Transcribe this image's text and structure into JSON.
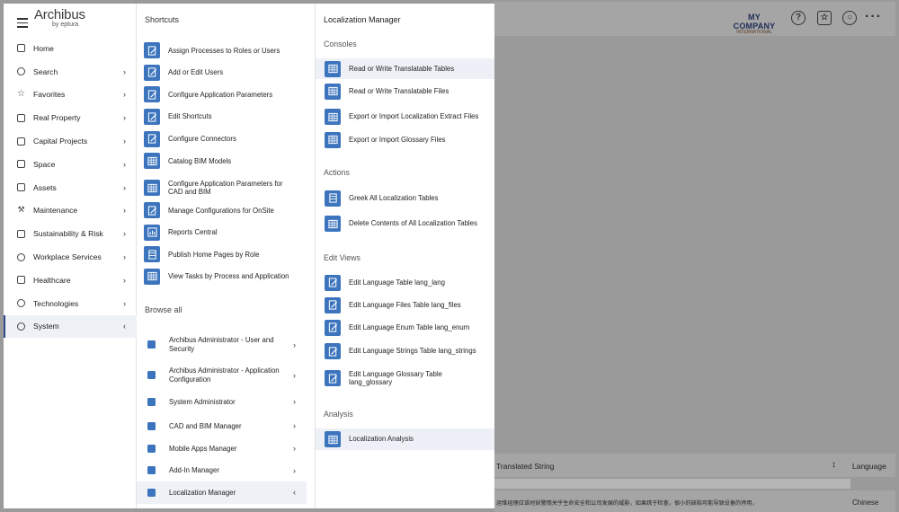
{
  "background": {
    "company_logo_line1": "MY COMPANY",
    "company_logo_line2": "INTERNATIONAL",
    "table_header_translated": "Translated String",
    "table_header_language": "Language",
    "row_text": "运维经理应该时刻警惕关乎生命安全和公司发展的威胁，如果疏于检查，很小的缺陷可能导致设备的停用，",
    "row_language": "Chinese",
    "icons": [
      "help-icon",
      "favorites-icon",
      "user-icon",
      "more-icon"
    ]
  },
  "nav": {
    "brand_name": "Archibus",
    "brand_by": "by eptura",
    "items": [
      {
        "label": "Home",
        "icon": "home-icon",
        "chevron": ""
      },
      {
        "label": "Search",
        "icon": "search-icon",
        "chevron": "›"
      },
      {
        "label": "Favorites",
        "icon": "star-icon",
        "chevron": "›"
      },
      {
        "label": "Real Property",
        "icon": "building-icon",
        "chevron": "›"
      },
      {
        "label": "Capital Projects",
        "icon": "projects-icon",
        "chevron": "›"
      },
      {
        "label": "Space",
        "icon": "space-icon",
        "chevron": "›"
      },
      {
        "label": "Assets",
        "icon": "assets-icon",
        "chevron": "›"
      },
      {
        "label": "Maintenance",
        "icon": "wrench-icon",
        "chevron": "›"
      },
      {
        "label": "Sustainability & Risk",
        "icon": "leaf-icon",
        "chevron": "›"
      },
      {
        "label": "Workplace Services",
        "icon": "services-icon",
        "chevron": "›"
      },
      {
        "label": "Healthcare",
        "icon": "healthcare-icon",
        "chevron": "›"
      },
      {
        "label": "Technologies",
        "icon": "bulb-icon",
        "chevron": "›"
      },
      {
        "label": "System",
        "icon": "gear-icon",
        "chevron": "‹"
      }
    ]
  },
  "shortcuts": {
    "title": "Shortcuts",
    "items": [
      "Assign Processes to Roles or Users",
      "Add or Edit Users",
      "Configure Application Parameters",
      "Edit Shortcuts",
      "Configure Connectors",
      "Catalog BIM Models",
      "Configure Application Parameters for CAD and BIM",
      "Manage Configurations for OnSite",
      "Reports Central",
      "Publish Home Pages by Role",
      "View Tasks by Process and Application"
    ],
    "browse_title": "Browse all",
    "browse_items": [
      "Archibus Administrator - User and Security",
      "Archibus Administrator - Application Configuration",
      "System Administrator",
      "CAD and BIM Manager",
      "Mobile Apps Manager",
      "Add-In Manager",
      "Localization Manager"
    ]
  },
  "localization": {
    "title": "Localization Manager",
    "consoles_title": "Consoles",
    "consoles": [
      "Read or Write Translatable Tables",
      "Read or Write Translatable Files",
      "Export or Import Localization Extract Files",
      "Export or Import Glossary Files"
    ],
    "actions_title": "Actions",
    "actions": [
      "Greek All Localization Tables",
      "Delete Contents of All Localization Tables"
    ],
    "edit_views_title": "Edit Views",
    "edit_views": [
      "Edit Language Table lang_lang",
      "Edit Language Files Table lang_files",
      "Edit Language Enum Table lang_enum",
      "Edit Language Strings Table lang_strings",
      "Edit Language Glossary Table lang_glossary"
    ],
    "analysis_title": "Analysis",
    "analysis": [
      "Localization Analysis"
    ]
  }
}
